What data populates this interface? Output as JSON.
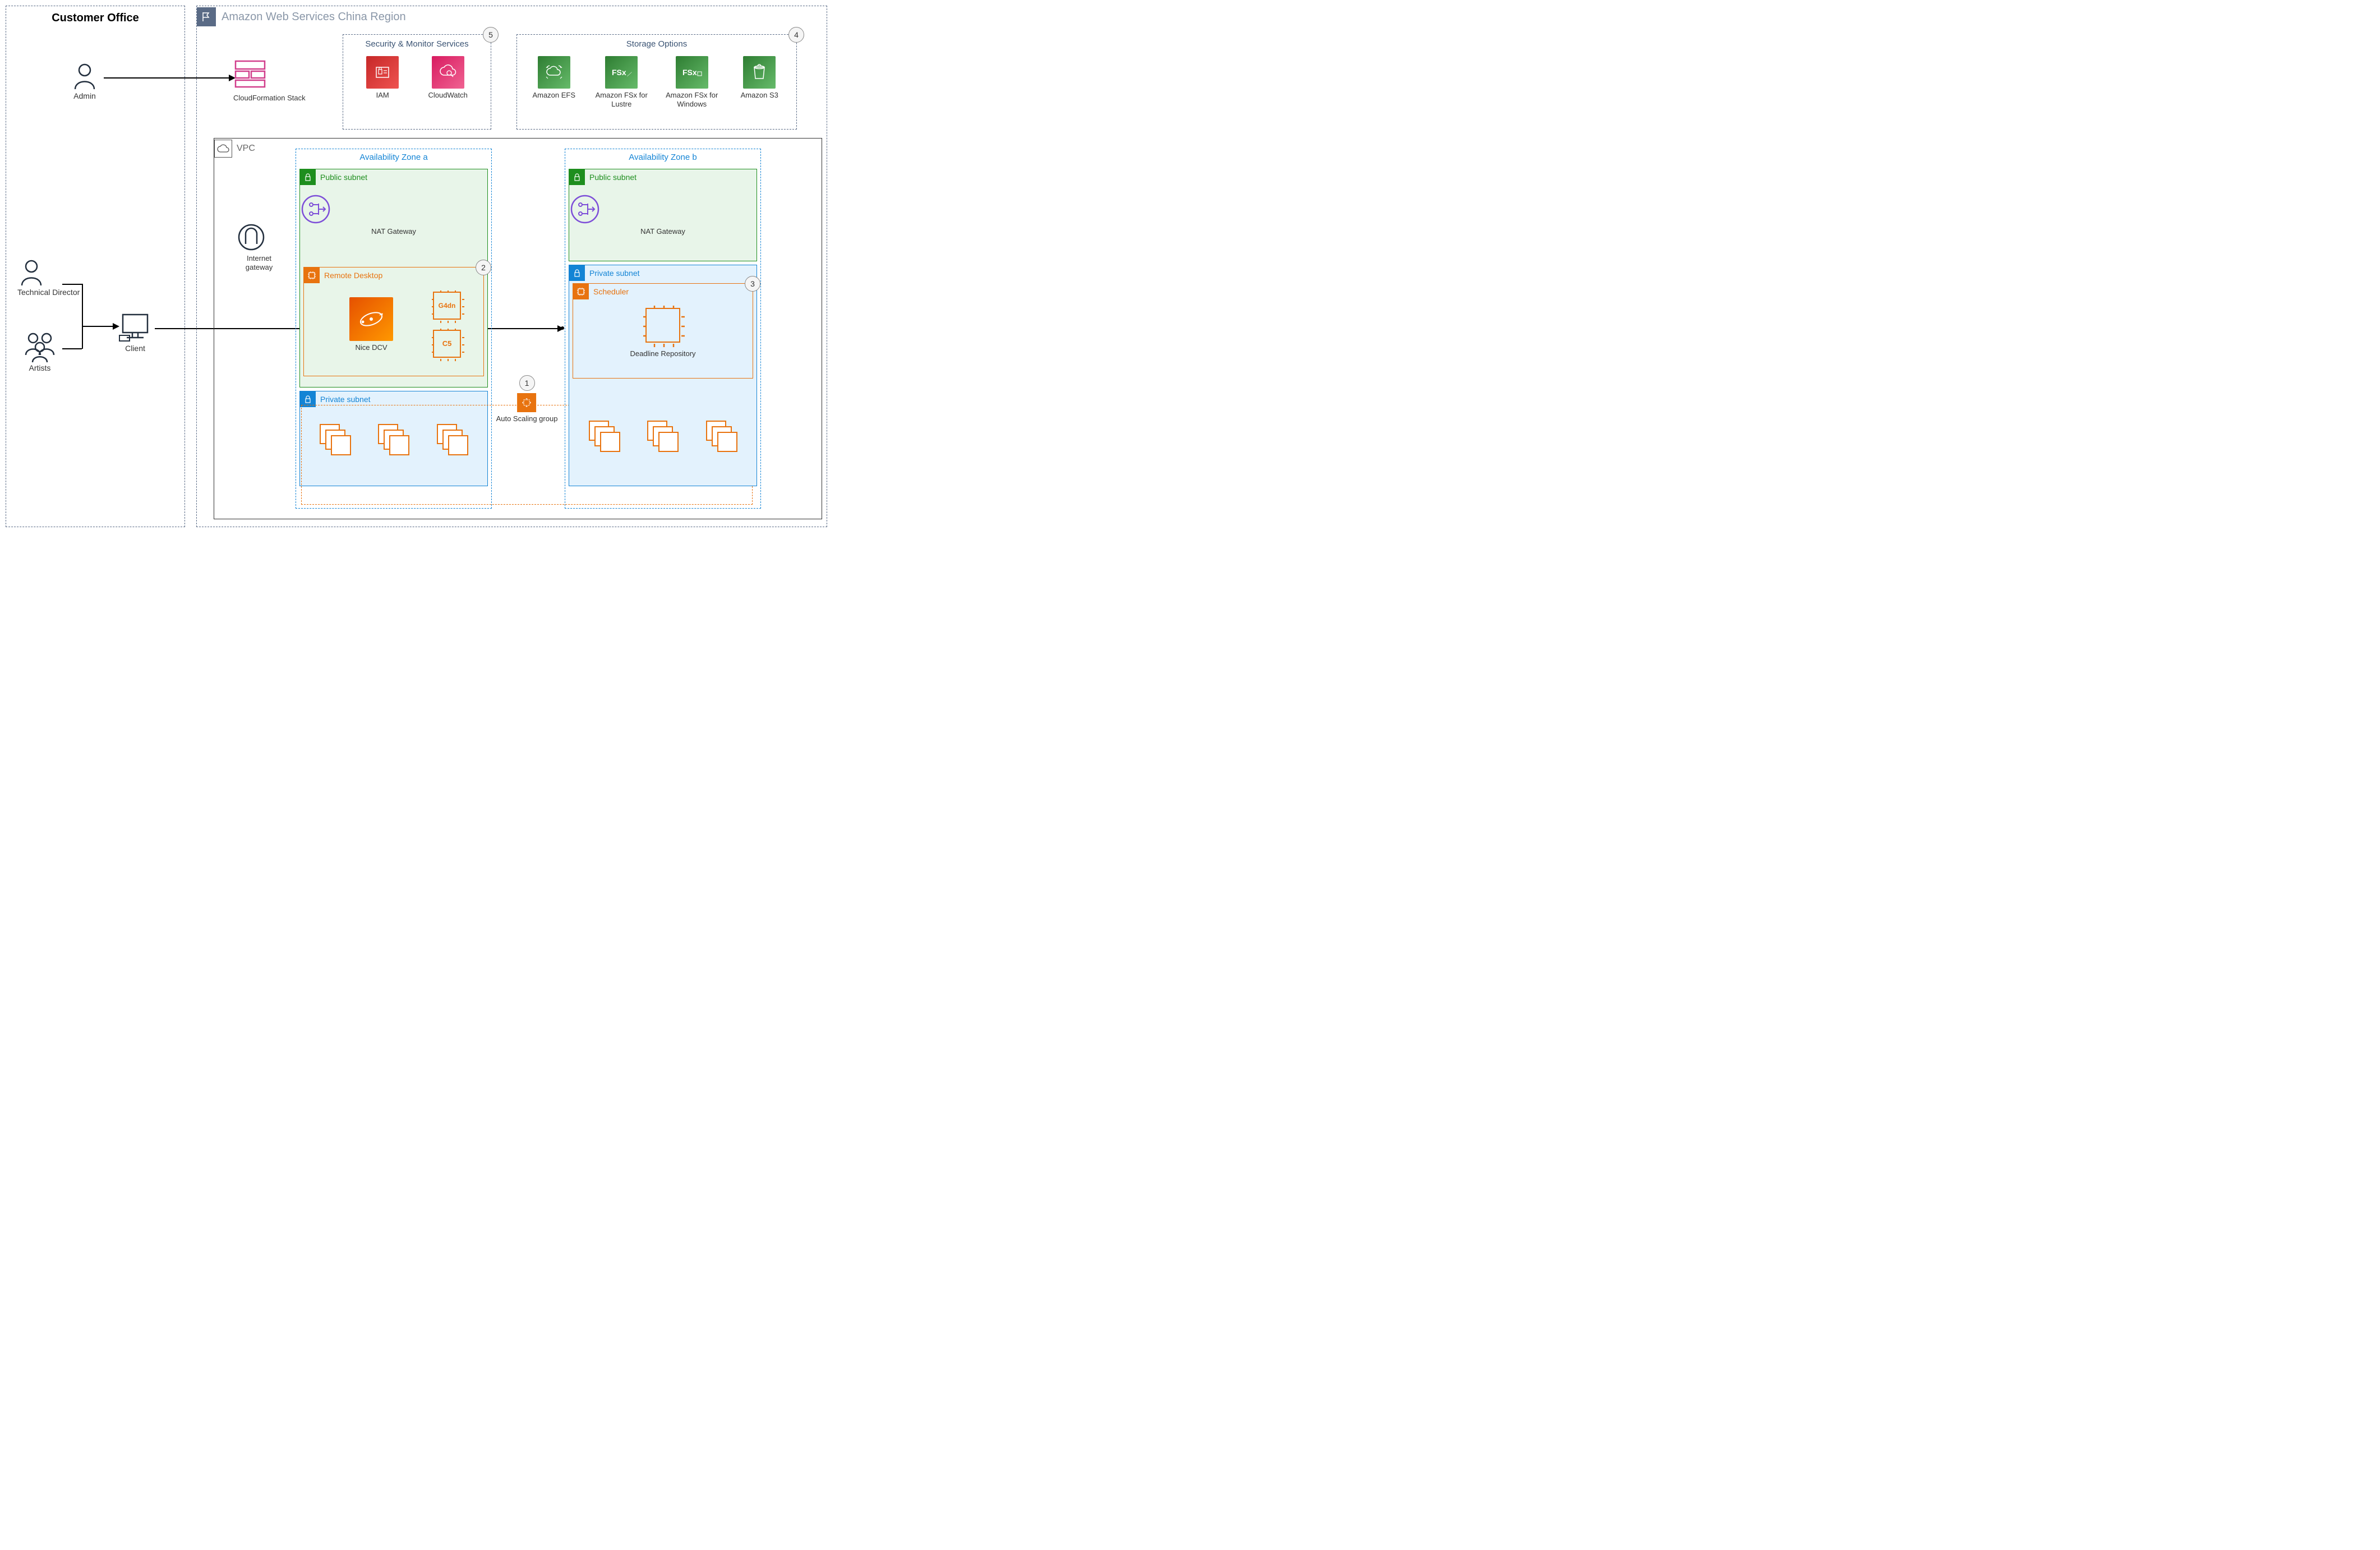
{
  "customer_office": {
    "title": "Customer Office",
    "admin": "Admin",
    "technical_director": "Technical Director",
    "artists": "Artists",
    "client": "Client"
  },
  "aws_region": {
    "title": "Amazon Web Services China Region",
    "cloudformation": "CloudFormation Stack",
    "security_box": {
      "title": "Security & Monitor Services",
      "iam": "IAM",
      "cloudwatch": "CloudWatch",
      "badge": "5"
    },
    "storage_box": {
      "title": "Storage Options",
      "efs": "Amazon EFS",
      "fsx_lustre": "Amazon FSx for Lustre",
      "fsx_windows": "Amazon FSx for Windows",
      "s3": "Amazon S3",
      "badge": "4"
    },
    "vpc": {
      "title": "VPC",
      "igw": "Internet gateway",
      "az_a": {
        "title": "Availability Zone a",
        "public_subnet": "Public subnet",
        "private_subnet": "Private subnet",
        "nat": "NAT Gateway",
        "remote_desktop": "Remote Desktop",
        "nice_dcv": "Nice DCV",
        "g4dn": "G4dn",
        "c5": "C5",
        "badge_rd": "2"
      },
      "az_b": {
        "title": "Availability Zone b",
        "public_subnet": "Public subnet",
        "private_subnet": "Private subnet",
        "nat": "NAT Gateway",
        "scheduler": "Scheduler",
        "deadline": "Deadline Repository",
        "badge_sched": "3"
      },
      "asg": {
        "label": "Auto Scaling group",
        "badge": "1"
      }
    }
  }
}
